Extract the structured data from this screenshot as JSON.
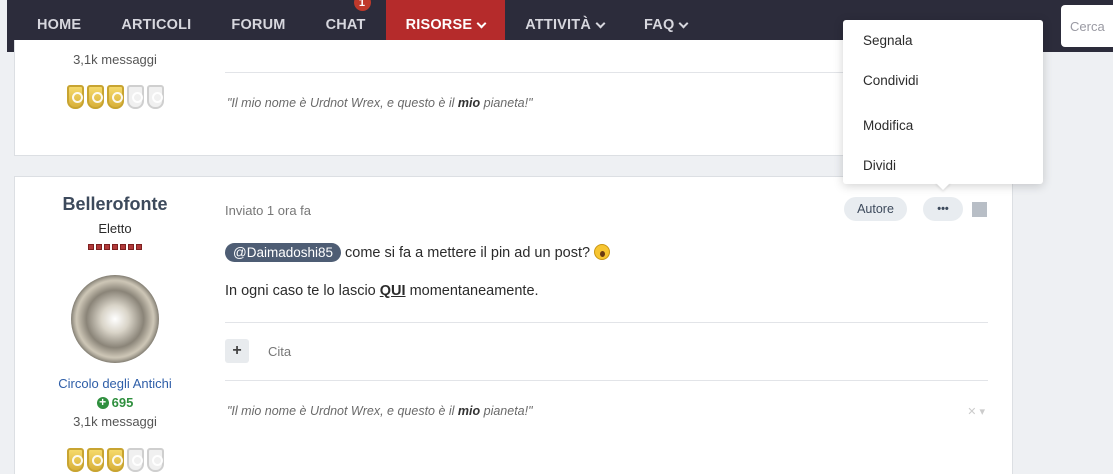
{
  "nav": {
    "items": [
      {
        "label": "HOME",
        "active": false,
        "has_chevron": false
      },
      {
        "label": "ARTICOLI",
        "active": false,
        "has_chevron": false
      },
      {
        "label": "FORUM",
        "active": false,
        "has_chevron": false
      },
      {
        "label": "CHAT",
        "active": false,
        "has_chevron": false,
        "badge": "1"
      },
      {
        "label": "RISORSE",
        "active": true,
        "has_chevron": true
      },
      {
        "label": "ATTIVITÀ",
        "active": false,
        "has_chevron": true
      },
      {
        "label": "FAQ",
        "active": false,
        "has_chevron": true
      }
    ],
    "search_placeholder": "Cerca",
    "colors": {
      "background": "#2c2c3b",
      "active": "#b52b2b"
    }
  },
  "post1": {
    "messages": "3,1k messaggi",
    "trophies": {
      "earned": 3,
      "total": 5
    },
    "signature": {
      "before": "\"Il mio nome è Urdnot Wrex, e questo è il ",
      "bold": "mio",
      "after": " pianeta!\""
    }
  },
  "post2": {
    "author_name": "Bellerofonte",
    "author_title": "Eletto",
    "rank_pips": 7,
    "group": "Circolo degli Antichi",
    "reputation": "695",
    "messages": "3,1k messaggi",
    "trophies": {
      "earned": 3,
      "total": 5
    },
    "posted": "Inviato 1 ora fa",
    "author_badge": "Autore",
    "more_button": "•••",
    "body": {
      "mention": "@Daimadoshi85",
      "line1_text": " come si fa a mettere il pin ad un post? ",
      "line2_before": "In ogni caso te lo lascio ",
      "line2_link": "QUI",
      "line2_after": " momentaneamente."
    },
    "quote_label": "Cita",
    "signature": {
      "before": "\"Il mio nome è Urdnot Wrex, e questo è il ",
      "bold": "mio",
      "after": " pianeta!\""
    },
    "signature_controls": "✕ ▾"
  },
  "dropdown": {
    "items": [
      "Segnala",
      "Condividi",
      "Modifica",
      "Dividi"
    ]
  }
}
